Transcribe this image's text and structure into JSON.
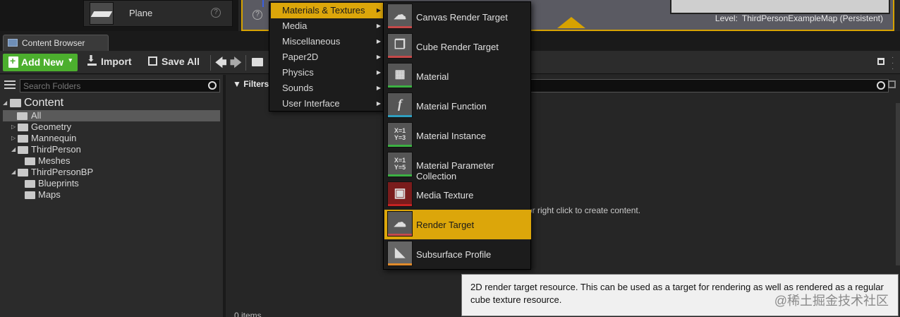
{
  "top": {
    "plane_label": "Plane",
    "help_glyph": "?",
    "level_prefix": "Level:",
    "level_name": "ThirdPersonExampleMap (Persistent)"
  },
  "tab": {
    "label": "Content Browser"
  },
  "toolbar": {
    "add_new": "Add New",
    "add_new_caret": "▾",
    "import": "Import",
    "save_all": "Save All",
    "back_glyph": "🡄",
    "forward_glyph": "🡆"
  },
  "folders": {
    "search_placeholder": "Search Folders",
    "tree": [
      {
        "label": "Content",
        "twisty": "◢"
      },
      {
        "label": "All"
      },
      {
        "label": "Geometry",
        "twisty": "▷"
      },
      {
        "label": "Mannequin",
        "twisty": "▷"
      },
      {
        "label": "ThirdPerson",
        "twisty": "◢"
      },
      {
        "label": "Meshes"
      },
      {
        "label": "ThirdPersonBP",
        "twisty": "◢"
      },
      {
        "label": "Blueprints"
      },
      {
        "label": "Maps"
      }
    ]
  },
  "content": {
    "filters": "▼ Filters ▾",
    "hint": "or right click to create content.",
    "items_count": "0 items"
  },
  "menu1": {
    "items": [
      {
        "label": "Materials & Textures",
        "active": true
      },
      {
        "label": "Media"
      },
      {
        "label": "Miscellaneous"
      },
      {
        "label": "Paper2D"
      },
      {
        "label": "Physics"
      },
      {
        "label": "Sounds"
      },
      {
        "label": "User Interface"
      }
    ],
    "arrow_glyph": "▶"
  },
  "menu2": {
    "items": [
      {
        "label": "Canvas Render Target",
        "icon": "cloud-icon",
        "stripe": "#c44a4a"
      },
      {
        "label": "Cube Render Target",
        "icon": "cube-icon",
        "stripe": "#c44a4a"
      },
      {
        "label": "Material",
        "icon": "sphere-icon",
        "stripe": "#3cb043"
      },
      {
        "label": "Material Function",
        "icon": "function-icon",
        "stripe": "#2f9fc0"
      },
      {
        "label": "Material Instance",
        "icon": "instance-icon",
        "stripe": "#3cb043"
      },
      {
        "label": "Material Parameter Collection",
        "icon": "collection-icon",
        "stripe": "#3cb043"
      },
      {
        "label": "Media Texture",
        "icon": "media-texture-icon",
        "stripe": "#c42222"
      },
      {
        "label": "Render Target",
        "icon": "cloud-icon",
        "stripe": "#c44a4a",
        "active": true
      },
      {
        "label": "Subsurface Profile",
        "icon": "profile-icon",
        "stripe": "#e08a2a"
      }
    ],
    "glyphs": {
      "function": "f",
      "instance": "X=1\nY=3",
      "collection": "X=1\nY=5"
    }
  },
  "tooltip": {
    "text": "2D render target resource.  This can be used as a target for rendering as well as rendered as a regular cube texture resource."
  },
  "watermark": "@稀土掘金技术社区"
}
